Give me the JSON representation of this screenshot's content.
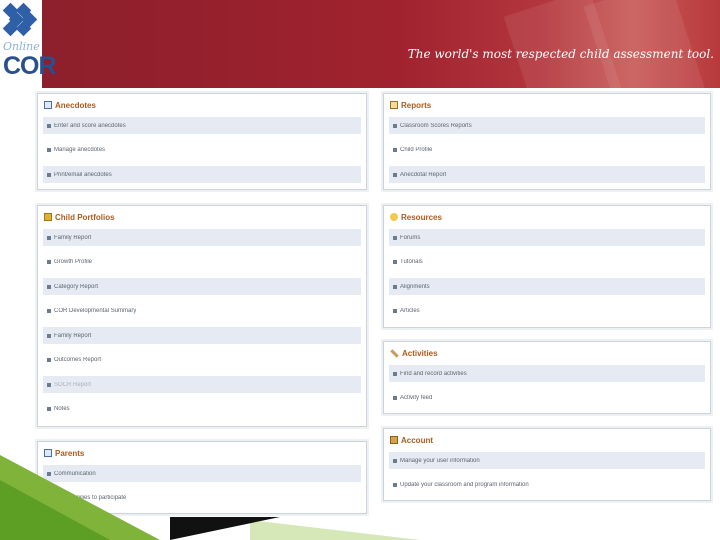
{
  "header": {
    "logo_top": "Online",
    "logo_main": "COR",
    "tagline": "The world's most respected child assessment tool."
  },
  "panels": {
    "anecdotes": {
      "title": "Anecdotes",
      "items": [
        "Enter and score anecdotes",
        "Manage anecdotes",
        "Print/email anecdotes"
      ]
    },
    "reports": {
      "title": "Reports",
      "items": [
        "Classroom Scores Reports",
        "Child Profile",
        "Anecdotal Report"
      ]
    },
    "child_portfolios": {
      "title": "Child Portfolios",
      "items": [
        "Family Report",
        "Growth Profile",
        "Category Report",
        "COR Developmental Summary",
        "Family Report",
        "Outcomes Report",
        "SOCR Report",
        "Notes"
      ]
    },
    "resources": {
      "title": "Resources",
      "items": [
        "Forums",
        "Tutorials",
        "Alignments",
        "Articles"
      ]
    },
    "activities": {
      "title": "Activities",
      "items": [
        "Find and record activities",
        "Activity feed"
      ]
    },
    "parents": {
      "title": "Parents",
      "items": [
        "Communication",
        "Invite families to participate"
      ]
    },
    "account": {
      "title": "Account",
      "items": [
        "Manage your user information",
        "Update your classroom and program information"
      ]
    }
  },
  "colors": {
    "banner": "#a0222f",
    "panel_title": "#b05a18",
    "row_shade": "#e6ebf3",
    "accent_green": "#7fb33a"
  }
}
